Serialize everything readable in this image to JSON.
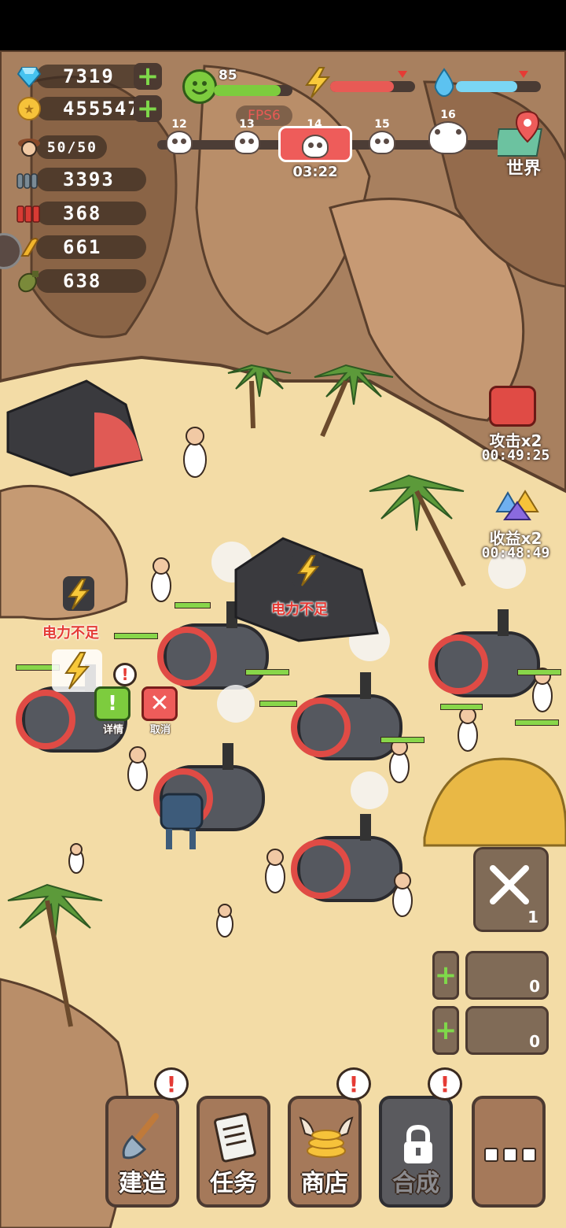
{
  "resources": {
    "diamond": "7319",
    "gold": "455547",
    "population": "50/50",
    "ammo_bullets": "3393",
    "ammo_shells": "368",
    "ammo_rifle": "661",
    "ammo_bombs": "638"
  },
  "stats": {
    "happiness": "85",
    "happiness_level": 0.85,
    "power_level": 0.75,
    "water_level": 0.72
  },
  "fps": "FPS6",
  "waves": [
    {
      "label": "12"
    },
    {
      "label": "13"
    },
    {
      "label": "14",
      "timer": "03:22"
    },
    {
      "label": "15"
    },
    {
      "label": "16"
    }
  ],
  "world_button": "世界",
  "boosts": {
    "attack_label": "攻击x2",
    "attack_timer": "00:49:25",
    "income_label": "收益x2",
    "income_timer": "00:48:49"
  },
  "warnings": {
    "power_insufficient": "电力不足"
  },
  "context_menu": {
    "details": "详情",
    "cancel": "取消"
  },
  "alert": "!",
  "side_tools": {
    "tools_count": "1",
    "slot1_count": "0",
    "slot2_count": "0"
  },
  "bottom_nav": {
    "build": "建造",
    "tasks": "任务",
    "shop": "商店",
    "merge": "合成"
  },
  "colors": {
    "sand": "#f3dca6",
    "rock": "#a0785a",
    "alert_red": "#e53b35",
    "plus_green": "#7fd84a"
  }
}
